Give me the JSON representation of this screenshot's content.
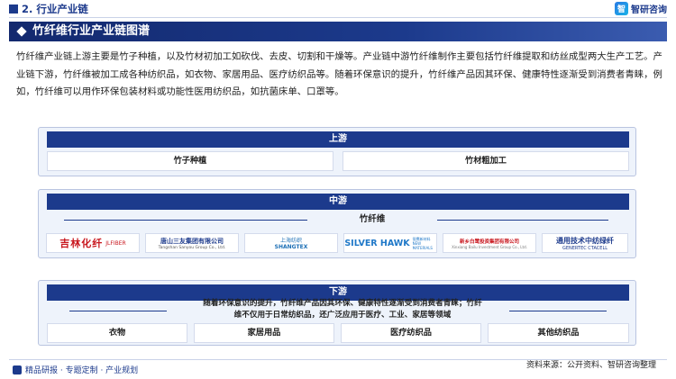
{
  "header": {
    "section_title": "2. 行业产业链",
    "brand_name": "智研咨询",
    "brand_mark": "智"
  },
  "banner": {
    "title": "竹纤维行业产业链图谱"
  },
  "intro": {
    "text": "竹纤维产业链上游主要是竹子种植，以及竹材初加工如砍伐、去皮、切割和干燥等。产业链中游竹纤维制作主要包括竹纤维提取和纺丝成型两大生产工艺。产业链下游，竹纤维被加工成各种纺织品，如衣物、家居用品、医疗纺织品等。随着环保意识的提升，竹纤维产品因其环保、健康特性逐渐受到消费者青睐，例如，竹纤维可以用作环保包装材料或功能性医用纺织品，如抗菌床单、口罩等。"
  },
  "upstream": {
    "title": "上游",
    "items": [
      "竹子种植",
      "竹材粗加工"
    ]
  },
  "midstream": {
    "title": "中游",
    "subtitle": "竹纤维",
    "companies": [
      {
        "name": "吉林化纤",
        "sub": "JLFIBER",
        "color": "#c8161d"
      },
      {
        "name": "唐山三友集团有限公司",
        "sub": "Tangshan Sanyou Group Co., Ltd.",
        "color": "#1c3a8c"
      },
      {
        "name": "上海纺织",
        "sub": "SHANGTEX",
        "color": "#1c6fb5"
      },
      {
        "name": "SILVER HAWK",
        "sub": "银鹰新材料 NEW MATERIALS",
        "color": "#1f78c8"
      },
      {
        "name": "新乡白鹭投资集团有限公司",
        "sub": "Xinxiang Bailu Investment Group Co., Ltd.",
        "color": "#c8161d"
      },
      {
        "name": "通用技术中纺绿纤",
        "sub": "GENERTEC CTACELL",
        "color": "#1c3a8c"
      }
    ]
  },
  "downstream": {
    "title": "下游",
    "description_line1": "随着环保意识的提升，竹纤维产品因其环保、健康特性逐渐受到消费者青睐；竹纤",
    "description_line2": "维不仅用于日常纺织品，还广泛应用于医疗、工业、家居等领域",
    "items": [
      "衣物",
      "家居用品",
      "医疗纺织品",
      "其他纺织品"
    ]
  },
  "footer": {
    "left_text": "精品研报 · 专题定制 · 产业规划",
    "right_text": "资料来源：公开资料、智研咨询整理"
  },
  "colors": {
    "primary": "#1c3a8c",
    "panel_bg": "#eef3fb",
    "panel_border": "#b9c4e0"
  }
}
